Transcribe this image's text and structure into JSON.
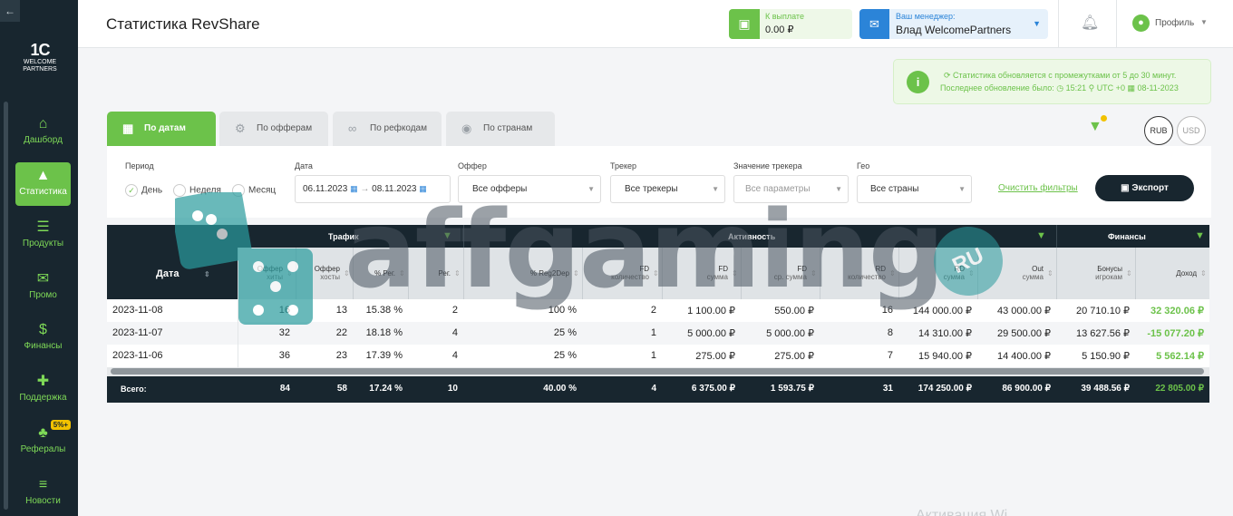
{
  "sidebar": {
    "back": "←",
    "logo_big": "1C",
    "logo_small1": "WELCOME",
    "logo_small2": "PARTNERS",
    "items": [
      {
        "label": "Дашборд",
        "icon": "home-icon",
        "glyph": "⌂"
      },
      {
        "label": "Статистика",
        "icon": "stats-icon",
        "glyph": "▲"
      },
      {
        "label": "Продукты",
        "icon": "list-icon",
        "glyph": "☰"
      },
      {
        "label": "Промо",
        "icon": "megaphone-icon",
        "glyph": "✉"
      },
      {
        "label": "Финансы",
        "icon": "wallet-icon",
        "glyph": "$"
      },
      {
        "label": "Поддержка",
        "icon": "lifebuoy-icon",
        "glyph": "✚"
      },
      {
        "label": "Рефералы",
        "icon": "referral-icon",
        "glyph": "♣",
        "badge": "5%+"
      },
      {
        "label": "Новости",
        "icon": "news-icon",
        "glyph": "≡"
      }
    ]
  },
  "header": {
    "title": "Статистика RevShare",
    "payout_label": "К выплате",
    "payout_value": "0.00 ₽",
    "manager_label": "Ваш менеджер:",
    "manager_name": "Влад WelcomePartners",
    "profile": "Профиль"
  },
  "notice": {
    "line1": "Статистика обновляется с промежутками от 5 до 30 минут.",
    "line2": "Последнее обновление было:  ◷ 15:21  ⚲ UTC +0  ▦ 08-11-2023"
  },
  "tabs": [
    {
      "label": "По датам",
      "glyph": "▦"
    },
    {
      "label": "По офферам",
      "glyph": "⚙"
    },
    {
      "label": "По рефкодам",
      "glyph": "∞"
    },
    {
      "label": "По странам",
      "glyph": "◉"
    }
  ],
  "currency": {
    "rub": "RUB",
    "usd": "USD"
  },
  "filters": {
    "period_label": "Период",
    "period_day": "День",
    "period_week": "Неделя",
    "period_month": "Месяц",
    "date_label": "Дата",
    "date_from": "06.11.2023",
    "date_to": "08.11.2023",
    "offer_label": "Оффер",
    "offer_value": "Все офферы",
    "tracker_label": "Трекер",
    "tracker_value": "Все трекеры",
    "tracker_val_label": "Значение трекера",
    "tracker_val_value": "Все параметры",
    "geo_label": "Гео",
    "geo_value": "Все страны",
    "clear": "Очистить фильтры",
    "export": "Экспорт"
  },
  "table": {
    "groups": {
      "traffic": "Трафик",
      "activity": "Активность",
      "finance": "Финансы"
    },
    "date_header": "Дата",
    "columns": [
      {
        "l1": "Оффер",
        "l2": "хиты"
      },
      {
        "l1": "Оффер",
        "l2": "хосты"
      },
      {
        "l1": "% Рег.",
        "l2": ""
      },
      {
        "l1": "Рег.",
        "l2": ""
      },
      {
        "l1": "% Reg2Dep",
        "l2": ""
      },
      {
        "l1": "FD",
        "l2": "количество"
      },
      {
        "l1": "FD",
        "l2": "сумма"
      },
      {
        "l1": "FD",
        "l2": "ср. сумма"
      },
      {
        "l1": "RD",
        "l2": "количество"
      },
      {
        "l1": "RD",
        "l2": "сумма"
      },
      {
        "l1": "Out",
        "l2": "сумма"
      },
      {
        "l1": "Бонусы",
        "l2": "игрокам"
      },
      {
        "l1": "Доход",
        "l2": ""
      }
    ],
    "rows": [
      {
        "date": "2023-11-08",
        "v": [
          "16",
          "13",
          "15.38 %",
          "2",
          "100 %",
          "2",
          "1 100.00 ₽",
          "550.00 ₽",
          "16",
          "144 000.00 ₽",
          "43 000.00 ₽",
          "20 710.10 ₽",
          "32 320.06 ₽"
        ]
      },
      {
        "date": "2023-11-07",
        "v": [
          "32",
          "22",
          "18.18 %",
          "4",
          "25 %",
          "1",
          "5 000.00 ₽",
          "5 000.00 ₽",
          "8",
          "14 310.00 ₽",
          "29 500.00 ₽",
          "13 627.56 ₽",
          "-15 077.20 ₽"
        ]
      },
      {
        "date": "2023-11-06",
        "v": [
          "36",
          "23",
          "17.39 %",
          "4",
          "25 %",
          "1",
          "275.00 ₽",
          "275.00 ₽",
          "7",
          "15 940.00 ₽",
          "14 400.00 ₽",
          "5 150.90 ₽",
          "5 562.14 ₽"
        ]
      }
    ],
    "total": {
      "label": "Всего:",
      "v": [
        "84",
        "58",
        "17.24 %",
        "10",
        "40.00 %",
        "4",
        "6 375.00 ₽",
        "1 593.75 ₽",
        "31",
        "174 250.00 ₽",
        "86 900.00 ₽",
        "39 488.56 ₽",
        "22 805.00 ₽"
      ]
    }
  },
  "watermark": {
    "text": "affgaming",
    "ru": "RU"
  },
  "os_overlay": "Активация Wi"
}
